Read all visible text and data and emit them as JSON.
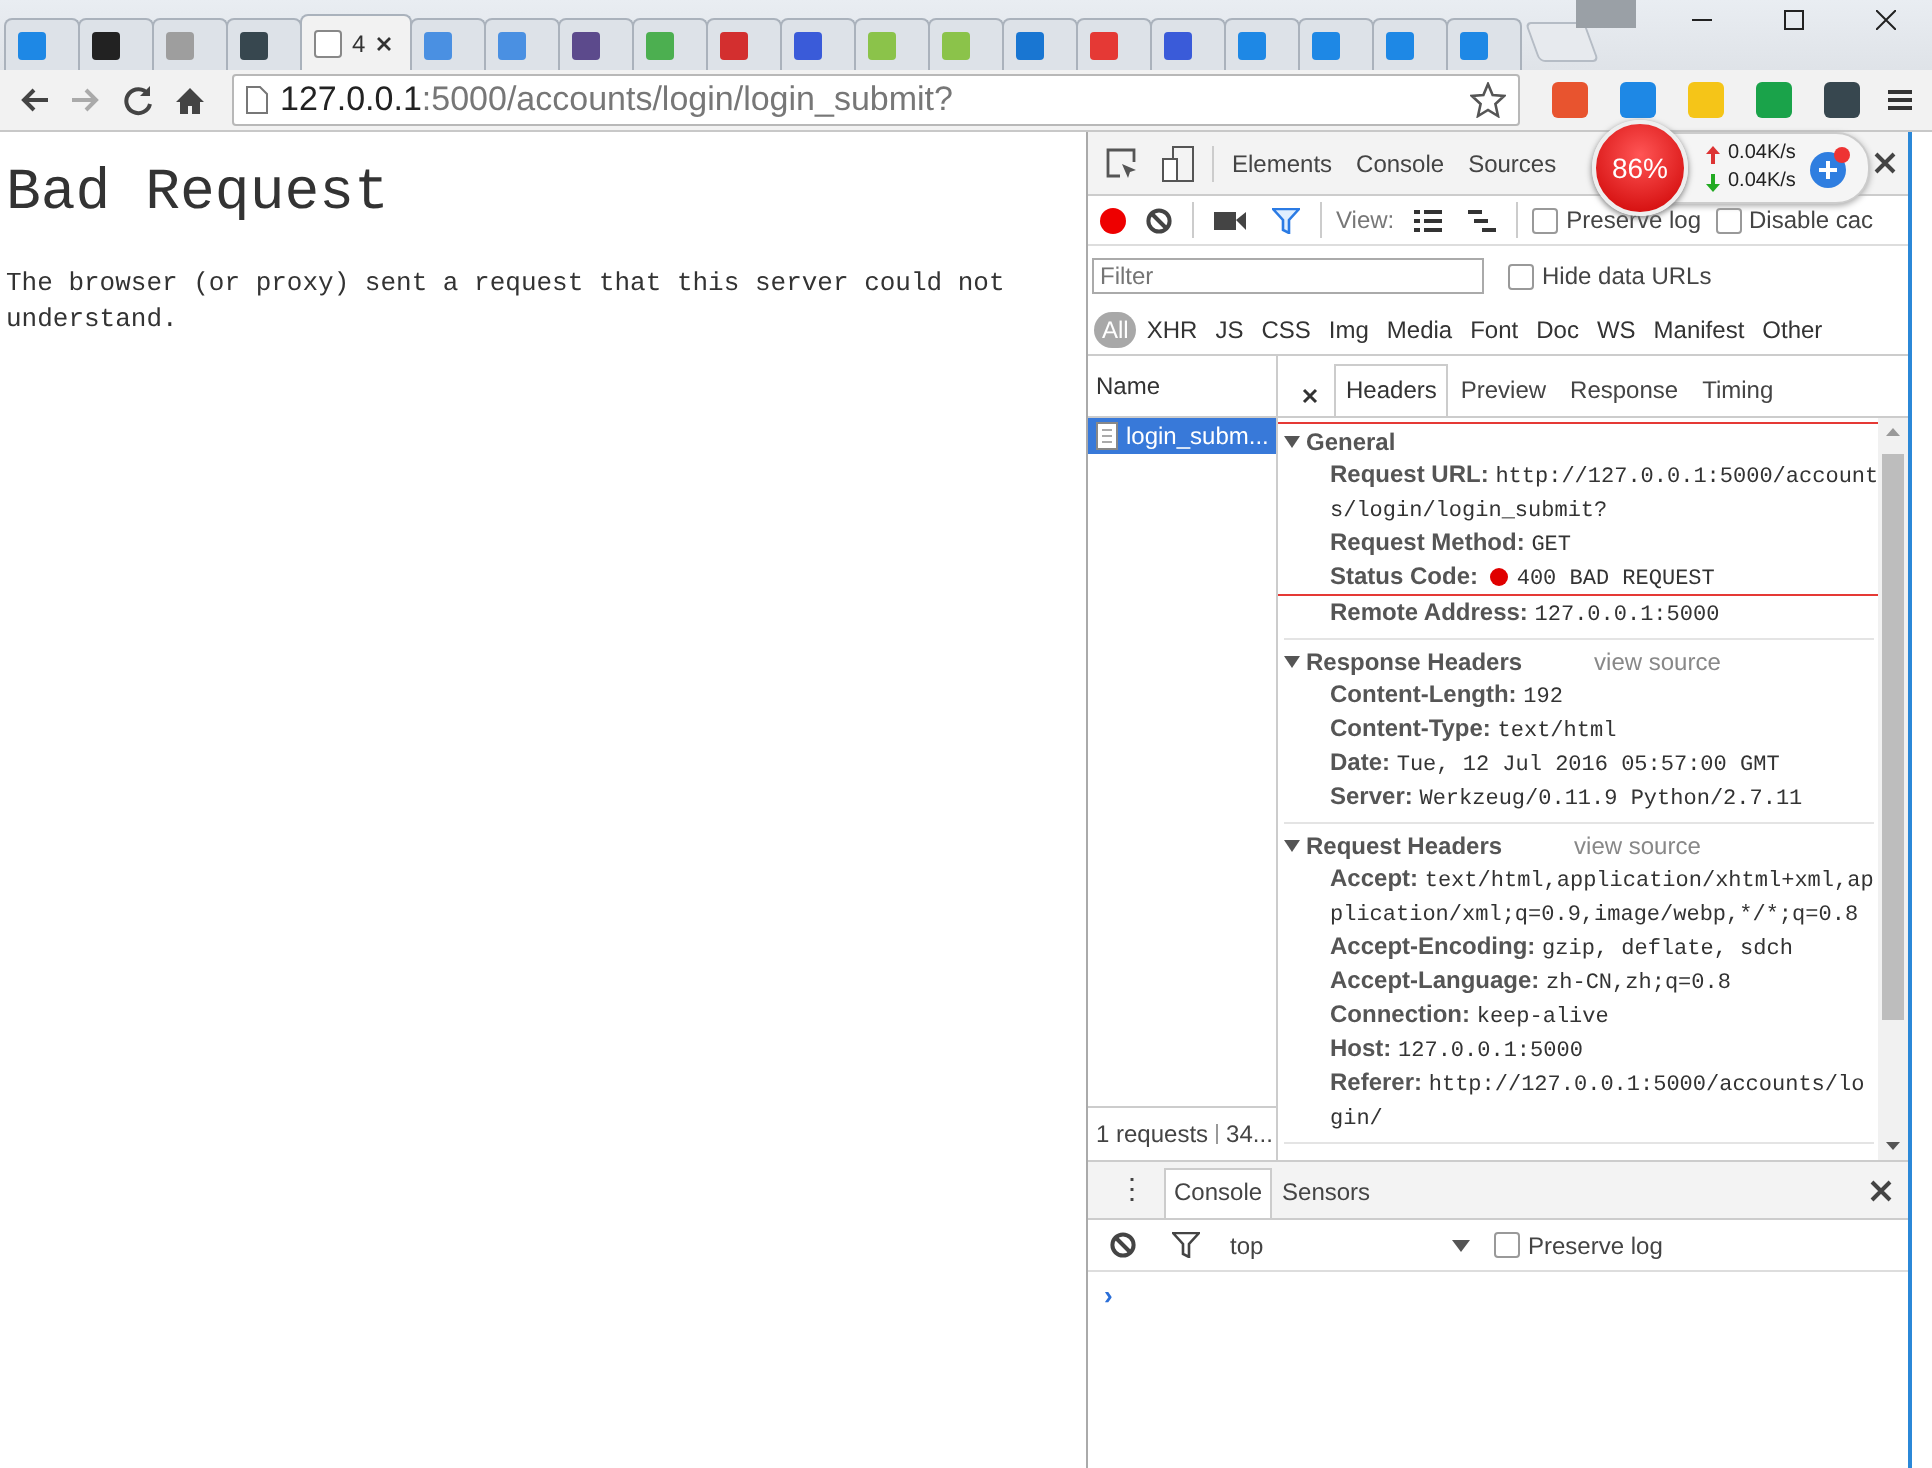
{
  "browser": {
    "tabs": [
      {
        "color": "#1e88e5",
        "selected": false
      },
      {
        "color": "#222222",
        "selected": false
      },
      {
        "color": "#9e9e9e",
        "selected": false
      },
      {
        "color": "#37474f",
        "selected": false
      },
      {
        "title": "4",
        "color": "#ffffff",
        "selected": true
      },
      {
        "color": "#4a90e2",
        "selected": false
      },
      {
        "color": "#4a90e2",
        "selected": false
      },
      {
        "color": "#5c4a8c",
        "selected": false
      },
      {
        "color": "#4caf50",
        "selected": false
      },
      {
        "color": "#d32f2f",
        "selected": false
      },
      {
        "color": "#3a5bd9",
        "selected": false
      },
      {
        "color": "#8bc34a",
        "selected": false
      },
      {
        "color": "#8bc34a",
        "selected": false
      },
      {
        "color": "#1976d2",
        "selected": false
      },
      {
        "color": "#e53935",
        "selected": false
      },
      {
        "color": "#3a5bd9",
        "selected": false
      },
      {
        "color": "#1e88e5",
        "selected": false
      },
      {
        "color": "#1e88e5",
        "selected": false
      },
      {
        "color": "#1e88e5",
        "selected": false
      },
      {
        "color": "#1e88e5",
        "selected": false
      }
    ],
    "url_host": "127.0.0.1",
    "url_rest": ":5000/accounts/login/login_submit?",
    "extensions": [
      {
        "color": "#e8542f"
      },
      {
        "color": "#1e88e5"
      },
      {
        "color": "#f5c518"
      },
      {
        "color": "#1aa34a"
      },
      {
        "color": "#37474f"
      }
    ]
  },
  "page": {
    "heading": "Bad Request",
    "message": "The browser (or proxy) sent a request that this server could not understand."
  },
  "devtools": {
    "panel_tabs": [
      {
        "label": "Elements"
      },
      {
        "label": "Console"
      },
      {
        "label": "Sources"
      }
    ],
    "speed_widget": {
      "percent": "86%",
      "upload": "0.04K/s",
      "download": "0.04K/s"
    },
    "toolbar": {
      "recording": true,
      "view_label": "View:",
      "options": [
        {
          "label": "Preserve log",
          "checked": false
        },
        {
          "label": "Disable cac",
          "checked": false
        }
      ]
    },
    "filter": {
      "placeholder": "Filter",
      "hide_data_urls": {
        "label": "Hide data URLs",
        "checked": false
      }
    },
    "types": [
      {
        "label": "All",
        "selected": true
      },
      {
        "label": "XHR",
        "selected": false
      },
      {
        "label": "JS",
        "selected": false
      },
      {
        "label": "CSS",
        "selected": false
      },
      {
        "label": "Img",
        "selected": false
      },
      {
        "label": "Media",
        "selected": false
      },
      {
        "label": "Font",
        "selected": false
      },
      {
        "label": "Doc",
        "selected": false
      },
      {
        "label": "WS",
        "selected": false
      },
      {
        "label": "Manifest",
        "selected": false
      },
      {
        "label": "Other",
        "selected": false
      }
    ],
    "requests": {
      "header": "Name",
      "items": [
        {
          "name": "login_subm...",
          "selected": true
        }
      ],
      "summary": "1 requests",
      "summary_more": "34..."
    },
    "detail_tabs": [
      {
        "label": "Headers",
        "selected": true
      },
      {
        "label": "Preview",
        "selected": false
      },
      {
        "label": "Response",
        "selected": false
      },
      {
        "label": "Timing",
        "selected": false
      }
    ],
    "sections": [
      {
        "title": "General",
        "expanded": true,
        "highlighted": true,
        "rows": [
          {
            "name": "Request URL:",
            "value": "http://127.0.0.1:5000/accounts/login/login_submit?",
            "highlighted": true
          },
          {
            "name": "Request Method:",
            "value": "GET",
            "highlighted": true
          },
          {
            "name": "Status Code:",
            "value": "400 BAD REQUEST",
            "color": "#e00000",
            "highlighted": true
          },
          {
            "name": "Remote Address:",
            "value": "127.0.0.1:5000",
            "highlighted": false
          }
        ]
      },
      {
        "title": "Response Headers",
        "link": "view source",
        "expanded": true,
        "highlighted": false,
        "rows": [
          {
            "name": "Content-Length:",
            "value": "192",
            "highlighted": false
          },
          {
            "name": "Content-Type:",
            "value": "text/html",
            "highlighted": false
          },
          {
            "name": "Date:",
            "value": "Tue, 12 Jul 2016 05:57:00 GMT",
            "highlighted": false
          },
          {
            "name": "Server:",
            "value": "Werkzeug/0.11.9 Python/2.7.11",
            "highlighted": false
          }
        ]
      },
      {
        "title": "Request Headers",
        "link": "view source",
        "expanded": true,
        "highlighted": false,
        "rows": [
          {
            "name": "Accept:",
            "value": "text/html,application/xhtml+xml,application/xml;q=0.9,image/webp,*/*;q=0.8",
            "highlighted": false
          },
          {
            "name": "Accept-Encoding:",
            "value": "gzip, deflate, sdch",
            "highlighted": false
          },
          {
            "name": "Accept-Language:",
            "value": "zh-CN,zh;q=0.8",
            "highlighted": false
          },
          {
            "name": "Connection:",
            "value": "keep-alive",
            "highlighted": false
          },
          {
            "name": "Host:",
            "value": "127.0.0.1:5000",
            "highlighted": false
          },
          {
            "name": "Referer:",
            "value": "http://127.0.0.1:5000/accounts/login/",
            "highlighted": false
          }
        ]
      }
    ],
    "drawer": {
      "menu_glyph": "⋮",
      "tabs": [
        {
          "label": "Console",
          "selected": true
        },
        {
          "label": "Sensors",
          "selected": false
        }
      ],
      "context": "top",
      "preserve_log": {
        "label": "Preserve log",
        "checked": false
      },
      "prompt": "›"
    }
  }
}
